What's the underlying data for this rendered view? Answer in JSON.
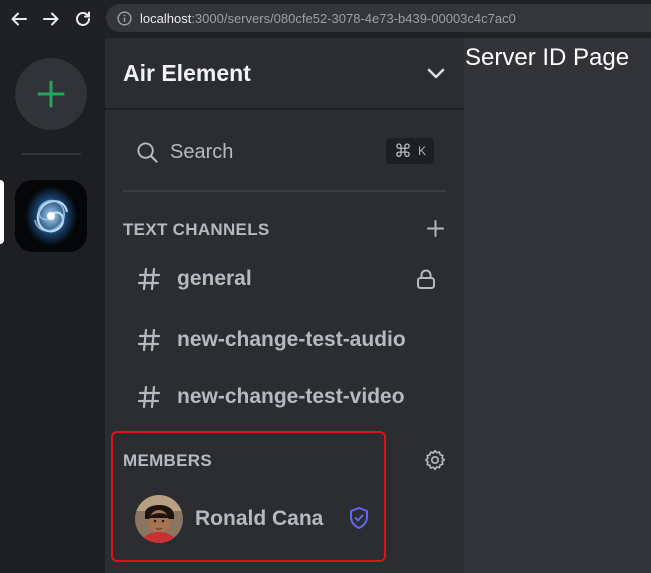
{
  "browser": {
    "url_host": "localhost",
    "url_rest": ":3000/servers/080cfe52-3078-4e73-b439-00003c4c7ac0"
  },
  "server": {
    "name": "Air Element"
  },
  "search": {
    "label": "Search",
    "shortcut_symbol": "⌘",
    "shortcut_key": "K"
  },
  "sections": {
    "text_channels": "TEXT CHANNELS",
    "members": "MEMBERS"
  },
  "channels": [
    {
      "name": "general",
      "locked": true
    },
    {
      "name": "new-change-test-audio",
      "locked": false
    },
    {
      "name": "new-change-test-video",
      "locked": false
    }
  ],
  "members": [
    {
      "name": "Ronald Cana",
      "role_icon": "shield-check-icon"
    }
  ],
  "main": {
    "title": "Server ID Page"
  },
  "colors": {
    "accent_green": "#23a55a",
    "role_blue": "#6366f1",
    "highlight_red": "#e0111a",
    "sidebar_bg": "#2b2d31",
    "rail_bg": "#1e1f22",
    "main_bg": "#313338"
  }
}
